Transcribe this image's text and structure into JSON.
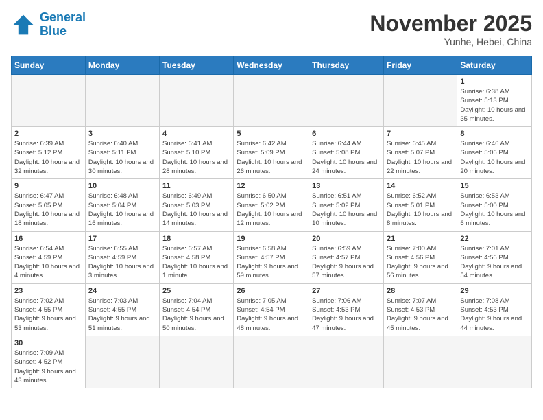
{
  "header": {
    "logo_general": "General",
    "logo_blue": "Blue",
    "month_title": "November 2025",
    "location": "Yunhe, Hebei, China"
  },
  "weekdays": [
    "Sunday",
    "Monday",
    "Tuesday",
    "Wednesday",
    "Thursday",
    "Friday",
    "Saturday"
  ],
  "weeks": [
    [
      {
        "day": "",
        "info": ""
      },
      {
        "day": "",
        "info": ""
      },
      {
        "day": "",
        "info": ""
      },
      {
        "day": "",
        "info": ""
      },
      {
        "day": "",
        "info": ""
      },
      {
        "day": "",
        "info": ""
      },
      {
        "day": "1",
        "info": "Sunrise: 6:38 AM\nSunset: 5:13 PM\nDaylight: 10 hours and 35 minutes."
      }
    ],
    [
      {
        "day": "2",
        "info": "Sunrise: 6:39 AM\nSunset: 5:12 PM\nDaylight: 10 hours and 32 minutes."
      },
      {
        "day": "3",
        "info": "Sunrise: 6:40 AM\nSunset: 5:11 PM\nDaylight: 10 hours and 30 minutes."
      },
      {
        "day": "4",
        "info": "Sunrise: 6:41 AM\nSunset: 5:10 PM\nDaylight: 10 hours and 28 minutes."
      },
      {
        "day": "5",
        "info": "Sunrise: 6:42 AM\nSunset: 5:09 PM\nDaylight: 10 hours and 26 minutes."
      },
      {
        "day": "6",
        "info": "Sunrise: 6:44 AM\nSunset: 5:08 PM\nDaylight: 10 hours and 24 minutes."
      },
      {
        "day": "7",
        "info": "Sunrise: 6:45 AM\nSunset: 5:07 PM\nDaylight: 10 hours and 22 minutes."
      },
      {
        "day": "8",
        "info": "Sunrise: 6:46 AM\nSunset: 5:06 PM\nDaylight: 10 hours and 20 minutes."
      }
    ],
    [
      {
        "day": "9",
        "info": "Sunrise: 6:47 AM\nSunset: 5:05 PM\nDaylight: 10 hours and 18 minutes."
      },
      {
        "day": "10",
        "info": "Sunrise: 6:48 AM\nSunset: 5:04 PM\nDaylight: 10 hours and 16 minutes."
      },
      {
        "day": "11",
        "info": "Sunrise: 6:49 AM\nSunset: 5:03 PM\nDaylight: 10 hours and 14 minutes."
      },
      {
        "day": "12",
        "info": "Sunrise: 6:50 AM\nSunset: 5:02 PM\nDaylight: 10 hours and 12 minutes."
      },
      {
        "day": "13",
        "info": "Sunrise: 6:51 AM\nSunset: 5:02 PM\nDaylight: 10 hours and 10 minutes."
      },
      {
        "day": "14",
        "info": "Sunrise: 6:52 AM\nSunset: 5:01 PM\nDaylight: 10 hours and 8 minutes."
      },
      {
        "day": "15",
        "info": "Sunrise: 6:53 AM\nSunset: 5:00 PM\nDaylight: 10 hours and 6 minutes."
      }
    ],
    [
      {
        "day": "16",
        "info": "Sunrise: 6:54 AM\nSunset: 4:59 PM\nDaylight: 10 hours and 4 minutes."
      },
      {
        "day": "17",
        "info": "Sunrise: 6:55 AM\nSunset: 4:59 PM\nDaylight: 10 hours and 3 minutes."
      },
      {
        "day": "18",
        "info": "Sunrise: 6:57 AM\nSunset: 4:58 PM\nDaylight: 10 hours and 1 minute."
      },
      {
        "day": "19",
        "info": "Sunrise: 6:58 AM\nSunset: 4:57 PM\nDaylight: 9 hours and 59 minutes."
      },
      {
        "day": "20",
        "info": "Sunrise: 6:59 AM\nSunset: 4:57 PM\nDaylight: 9 hours and 57 minutes."
      },
      {
        "day": "21",
        "info": "Sunrise: 7:00 AM\nSunset: 4:56 PM\nDaylight: 9 hours and 56 minutes."
      },
      {
        "day": "22",
        "info": "Sunrise: 7:01 AM\nSunset: 4:56 PM\nDaylight: 9 hours and 54 minutes."
      }
    ],
    [
      {
        "day": "23",
        "info": "Sunrise: 7:02 AM\nSunset: 4:55 PM\nDaylight: 9 hours and 53 minutes."
      },
      {
        "day": "24",
        "info": "Sunrise: 7:03 AM\nSunset: 4:55 PM\nDaylight: 9 hours and 51 minutes."
      },
      {
        "day": "25",
        "info": "Sunrise: 7:04 AM\nSunset: 4:54 PM\nDaylight: 9 hours and 50 minutes."
      },
      {
        "day": "26",
        "info": "Sunrise: 7:05 AM\nSunset: 4:54 PM\nDaylight: 9 hours and 48 minutes."
      },
      {
        "day": "27",
        "info": "Sunrise: 7:06 AM\nSunset: 4:53 PM\nDaylight: 9 hours and 47 minutes."
      },
      {
        "day": "28",
        "info": "Sunrise: 7:07 AM\nSunset: 4:53 PM\nDaylight: 9 hours and 45 minutes."
      },
      {
        "day": "29",
        "info": "Sunrise: 7:08 AM\nSunset: 4:53 PM\nDaylight: 9 hours and 44 minutes."
      }
    ],
    [
      {
        "day": "30",
        "info": "Sunrise: 7:09 AM\nSunset: 4:52 PM\nDaylight: 9 hours and 43 minutes."
      },
      {
        "day": "",
        "info": ""
      },
      {
        "day": "",
        "info": ""
      },
      {
        "day": "",
        "info": ""
      },
      {
        "day": "",
        "info": ""
      },
      {
        "day": "",
        "info": ""
      },
      {
        "day": "",
        "info": ""
      }
    ]
  ]
}
